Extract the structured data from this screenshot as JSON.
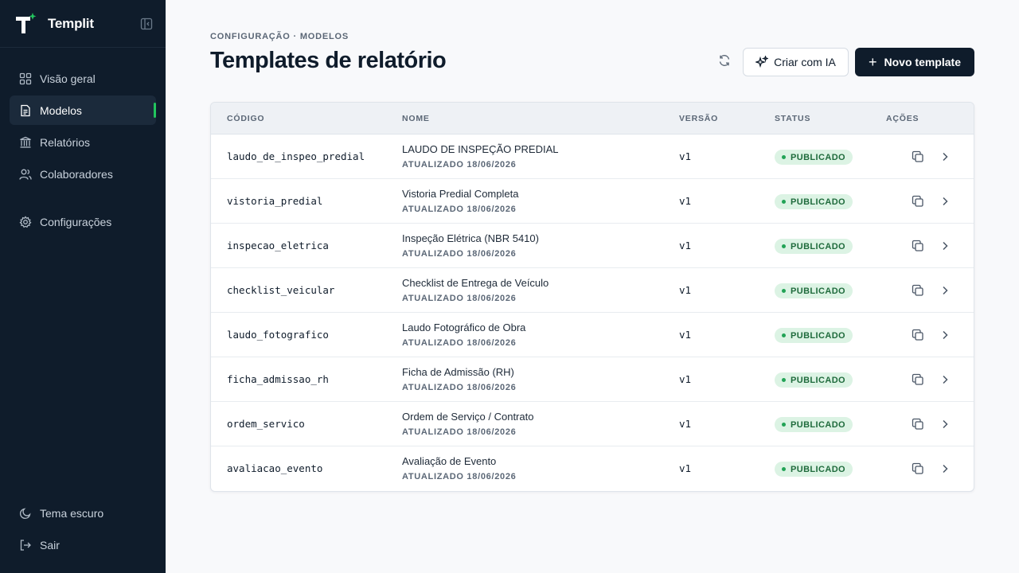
{
  "app": {
    "name": "Templit"
  },
  "sidebar": {
    "items": [
      {
        "label": "Visão geral",
        "icon": "grid-icon"
      },
      {
        "label": "Modelos",
        "icon": "document-icon",
        "active": true
      },
      {
        "label": "Relatórios",
        "icon": "library-icon"
      },
      {
        "label": "Colaboradores",
        "icon": "users-icon"
      },
      {
        "label": "Configurações",
        "icon": "gear-icon"
      }
    ],
    "bottom": [
      {
        "label": "Tema escuro",
        "icon": "moon-icon"
      },
      {
        "label": "Sair",
        "icon": "logout-icon"
      }
    ]
  },
  "header": {
    "breadcrumb": "CONFIGURAÇÃO · MODELOS",
    "title": "Templates de relatório",
    "ai_button": "Criar com IA",
    "new_button": "Novo template"
  },
  "table": {
    "columns": [
      "CÓDIGO",
      "NOME",
      "VERSÃO",
      "STATUS",
      "AÇÕES"
    ],
    "rows": [
      {
        "code": "laudo_de_inspeo_predial",
        "name": "LAUDO DE INSPEÇÃO PREDIAL",
        "updated": "ATUALIZADO 18/06/2026",
        "version": "v1",
        "status": "PUBLICADO"
      },
      {
        "code": "vistoria_predial",
        "name": "Vistoria Predial Completa",
        "updated": "ATUALIZADO 18/06/2026",
        "version": "v1",
        "status": "PUBLICADO"
      },
      {
        "code": "inspecao_eletrica",
        "name": "Inspeção Elétrica (NBR 5410)",
        "updated": "ATUALIZADO 18/06/2026",
        "version": "v1",
        "status": "PUBLICADO"
      },
      {
        "code": "checklist_veicular",
        "name": "Checklist de Entrega de Veículo",
        "updated": "ATUALIZADO 18/06/2026",
        "version": "v1",
        "status": "PUBLICADO"
      },
      {
        "code": "laudo_fotografico",
        "name": "Laudo Fotográfico de Obra",
        "updated": "ATUALIZADO 18/06/2026",
        "version": "v1",
        "status": "PUBLICADO"
      },
      {
        "code": "ficha_admissao_rh",
        "name": "Ficha de Admissão (RH)",
        "updated": "ATUALIZADO 18/06/2026",
        "version": "v1",
        "status": "PUBLICADO"
      },
      {
        "code": "ordem_servico",
        "name": "Ordem de Serviço / Contrato",
        "updated": "ATUALIZADO 18/06/2026",
        "version": "v1",
        "status": "PUBLICADO"
      },
      {
        "code": "avaliacao_evento",
        "name": "Avaliação de Evento",
        "updated": "ATUALIZADO 18/06/2026",
        "version": "v1",
        "status": "PUBLICADO"
      }
    ]
  },
  "colors": {
    "sidebar_bg": "#0f1c2b",
    "accent": "#22c55e",
    "badge_bg": "#dcf3e4",
    "badge_text": "#1f6b3c"
  }
}
